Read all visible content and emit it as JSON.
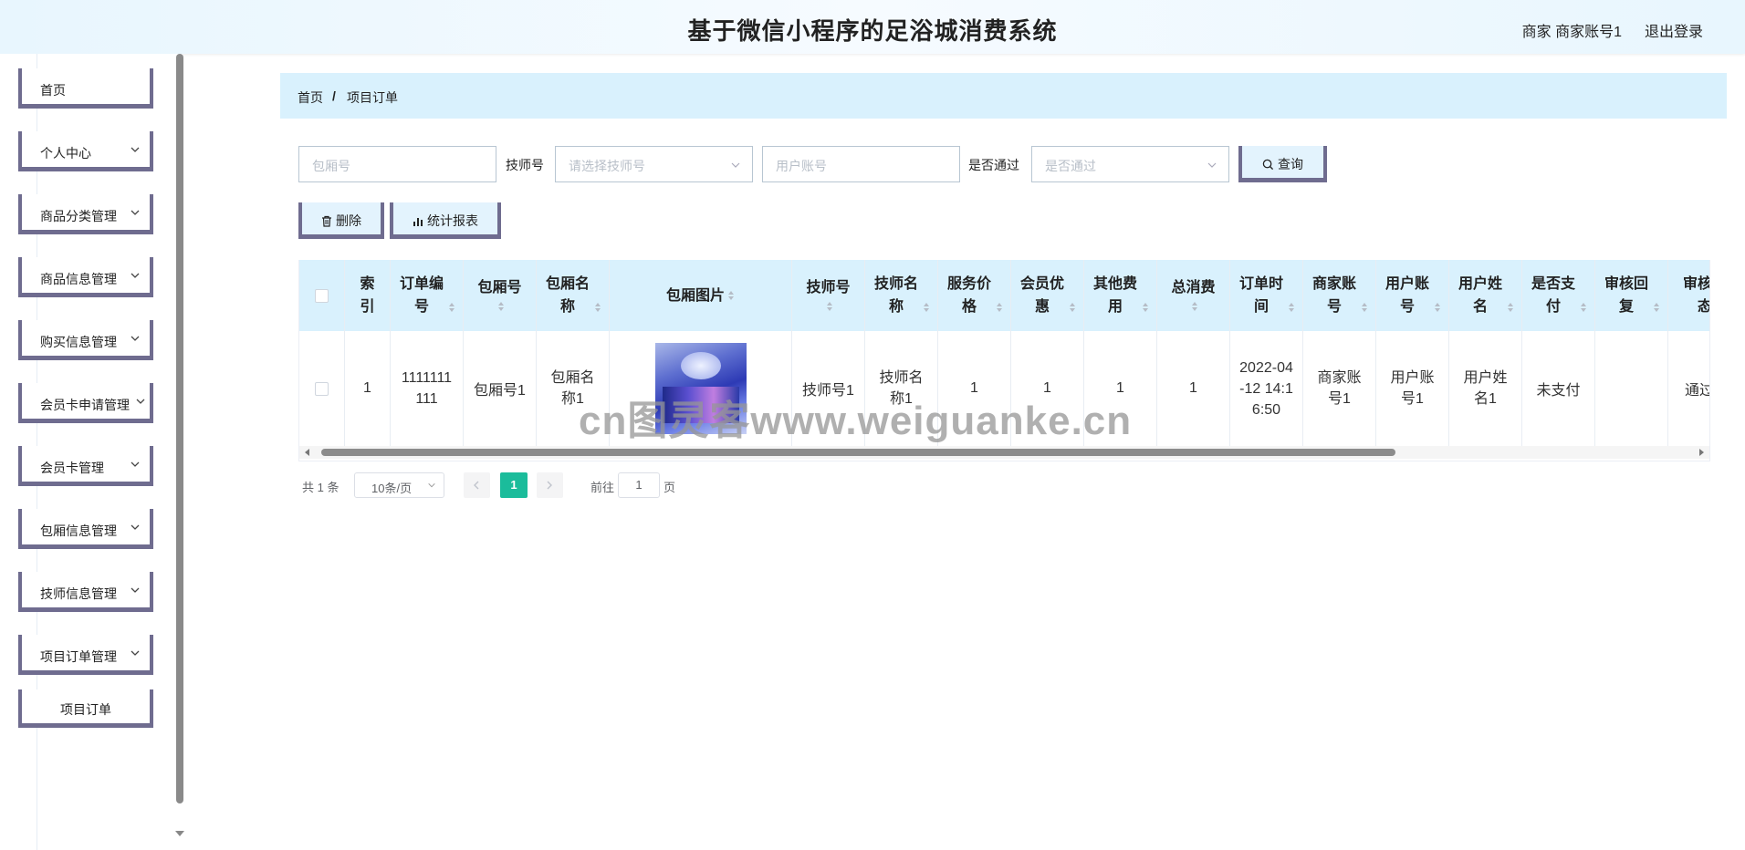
{
  "header": {
    "title": "基于微信小程序的足浴城消费系统",
    "user": "商家 商家账号1",
    "logout": "退出登录"
  },
  "sidebar": {
    "items": [
      {
        "label": "首页"
      },
      {
        "label": "个人中心"
      },
      {
        "label": "商品分类管理"
      },
      {
        "label": "商品信息管理"
      },
      {
        "label": "购买信息管理"
      },
      {
        "label": "会员卡申请管理"
      },
      {
        "label": "会员卡管理"
      },
      {
        "label": "包厢信息管理"
      },
      {
        "label": "技师信息管理"
      },
      {
        "label": "项目订单管理"
      },
      {
        "label": "项目订单"
      }
    ]
  },
  "breadcrumb": {
    "home": "首页",
    "sep": "/",
    "current": "项目订单"
  },
  "search": {
    "room_no_placeholder": "包厢号",
    "tech_label": "技师号",
    "tech_placeholder": "请选择技师号",
    "user_placeholder": "用户账号",
    "pass_label": "是否通过",
    "pass_placeholder": "是否通过",
    "query": "查询"
  },
  "actions": {
    "delete": "删除",
    "report": "统计报表"
  },
  "table": {
    "columns": [
      "索引",
      "订单编号",
      "包厢号",
      "包厢名称",
      "包厢图片",
      "技师号",
      "技师名称",
      "服务价格",
      "会员优惠",
      "其他费用",
      "总消费",
      "订单时间",
      "商家账号",
      "用户账号",
      "用户姓名",
      "是否支付",
      "审核回复",
      "审核状态"
    ],
    "rows": [
      {
        "index": "1",
        "order_no": "1111111111",
        "room_no": "包厢号1",
        "room_name": "包厢名称1",
        "tech_no": "技师号1",
        "tech_name": "技师名称1",
        "price": "1",
        "discount": "1",
        "other": "1",
        "total": "1",
        "time": "2022-04-12 14:16:50",
        "merchant": "商家账号1",
        "user_acc": "用户账号1",
        "user_name": "用户姓名1",
        "paid": "未支付",
        "reply": "",
        "status": "通过"
      }
    ]
  },
  "pagination": {
    "total": "共 1 条",
    "size": "10条/页",
    "current": "1",
    "goto": "前往",
    "goto_value": "1",
    "page_unit": "页"
  },
  "watermark": "cn图灵客www.weiguanke.cn"
}
